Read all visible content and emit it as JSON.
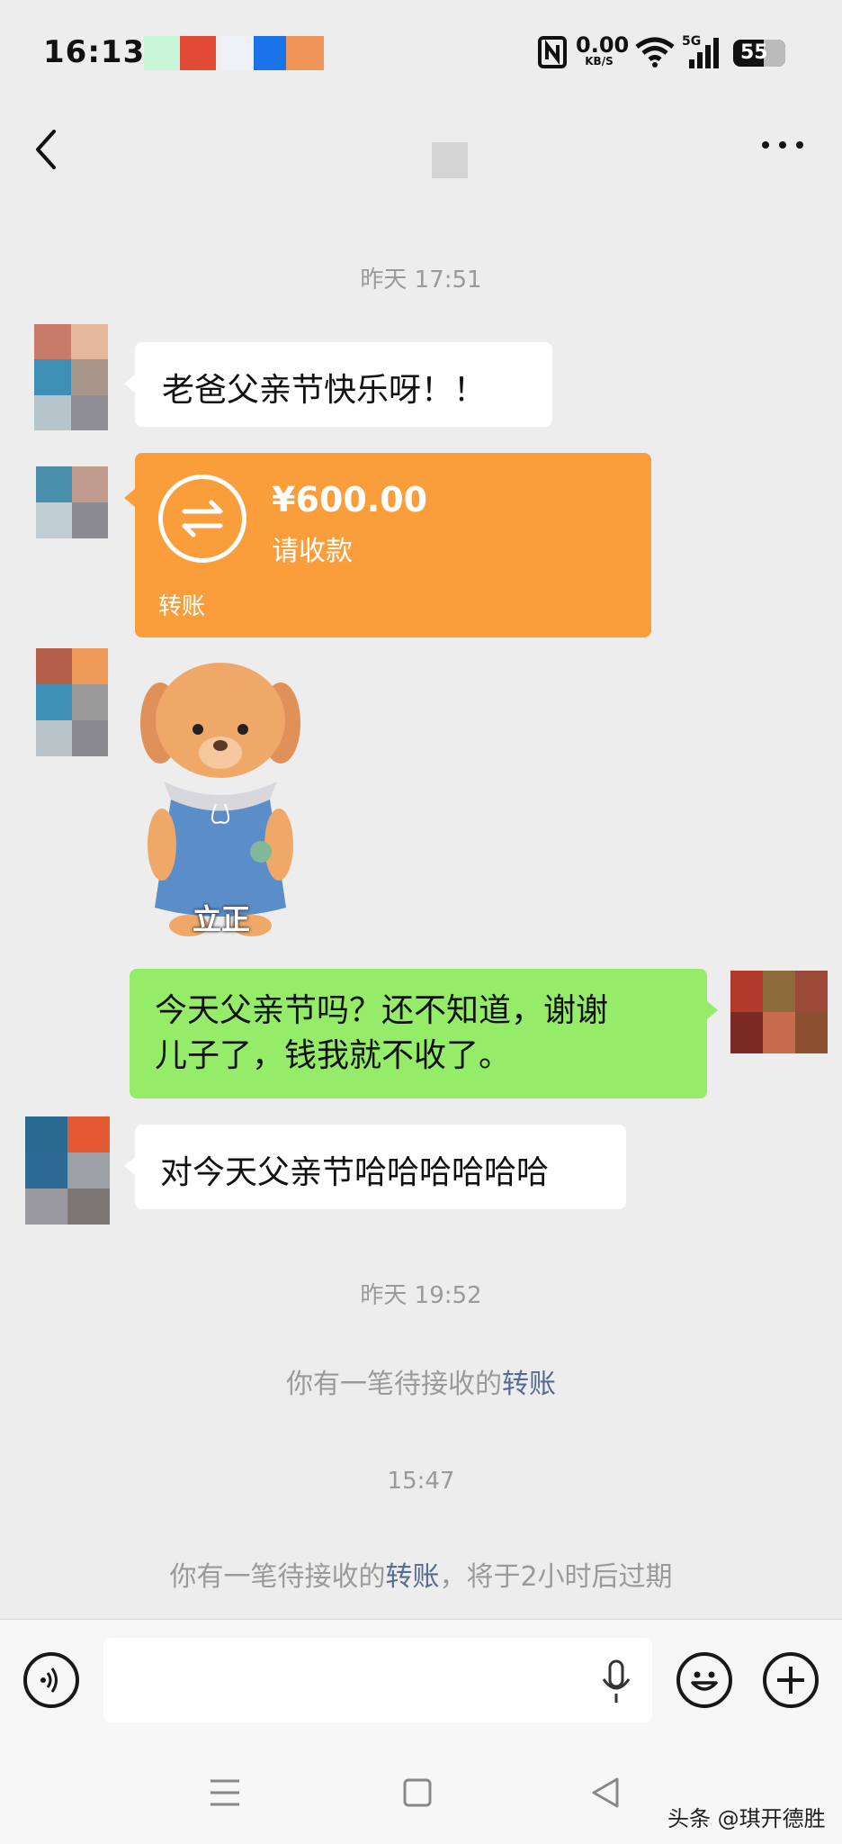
{
  "status_bar": {
    "time": "16:13",
    "net_speed_value": "0.00",
    "net_speed_unit": "KB/S",
    "signal_label": "5G",
    "battery": "55"
  },
  "header": {
    "back_icon": "chevron-left-icon",
    "more_icon": "more-dots-icon"
  },
  "chat": {
    "timestamp_1": "昨天 17:51",
    "msg_1": "老爸父亲节快乐呀！！",
    "transfer": {
      "amount": "¥600.00",
      "subtitle": "请收款",
      "label": "转账"
    },
    "sticker_caption": "立正",
    "msg_reply_line1": "今天父亲节吗？还不知道，谢谢",
    "msg_reply_line2": "儿子了，钱我就不收了。",
    "msg_3": "对今天父亲节哈哈哈哈哈哈",
    "timestamp_2": "昨天 19:52",
    "system_1_prefix": "你有一笔待接收的",
    "system_1_link": "转账",
    "timestamp_3": "15:47",
    "system_2_prefix": "你有一笔待接收的",
    "system_2_link": "转账",
    "system_2_suffix": "，将于2小时后过期"
  },
  "input_bar": {
    "voice_icon": "voice-icon",
    "mic_icon": "microphone-icon",
    "emoji_icon": "emoji-icon",
    "plus_icon": "plus-icon"
  },
  "watermark": "头条 @琪开德胜",
  "colors": {
    "background": "#ededed",
    "transfer_orange": "#fa9d3b",
    "self_bubble_green": "#95ec69",
    "link_blue": "#576b95"
  }
}
